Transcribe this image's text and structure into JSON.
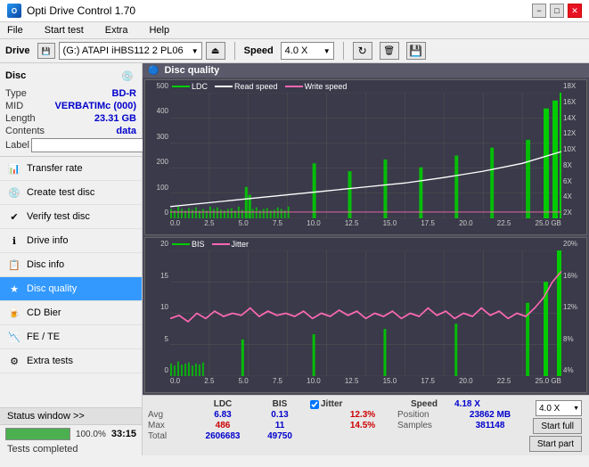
{
  "titlebar": {
    "title": "Opti Drive Control 1.70",
    "icon": "O",
    "minimize": "−",
    "maximize": "□",
    "close": "✕"
  },
  "menubar": {
    "items": [
      "File",
      "Start test",
      "Extra",
      "Help"
    ]
  },
  "toolbar": {
    "drive_label": "Drive",
    "drive_value": "(G:) ATAPI iHBS112  2 PL06",
    "speed_label": "Speed",
    "speed_value": "4.0 X"
  },
  "disc": {
    "title": "Disc",
    "type_label": "Type",
    "type_value": "BD-R",
    "mid_label": "MID",
    "mid_value": "VERBATIMc (000)",
    "length_label": "Length",
    "length_value": "23.31 GB",
    "contents_label": "Contents",
    "contents_value": "data",
    "label_label": "Label",
    "label_placeholder": ""
  },
  "sidebar": {
    "items": [
      {
        "id": "transfer-rate",
        "label": "Transfer rate",
        "icon": "📊"
      },
      {
        "id": "create-test-disc",
        "label": "Create test disc",
        "icon": "💿"
      },
      {
        "id": "verify-test-disc",
        "label": "Verify test disc",
        "icon": "✔"
      },
      {
        "id": "drive-info",
        "label": "Drive info",
        "icon": "ℹ"
      },
      {
        "id": "disc-info",
        "label": "Disc info",
        "icon": "📋"
      },
      {
        "id": "disc-quality",
        "label": "Disc quality",
        "icon": "★",
        "active": true
      },
      {
        "id": "cd-bier",
        "label": "CD Bier",
        "icon": "🍺"
      },
      {
        "id": "fe-te",
        "label": "FE / TE",
        "icon": "📉"
      },
      {
        "id": "extra-tests",
        "label": "Extra tests",
        "icon": "⚙"
      }
    ]
  },
  "status": {
    "window_btn": "Status window >>",
    "message": "Tests completed",
    "progress": 100,
    "progress_text": "100.0%",
    "time": "33:15"
  },
  "disc_quality": {
    "title": "Disc quality"
  },
  "chart_top": {
    "legend": [
      {
        "label": "LDC",
        "color": "#00ff00"
      },
      {
        "label": "Read speed",
        "color": "#ffffff"
      },
      {
        "label": "Write speed",
        "color": "#ff69b4"
      }
    ],
    "y_left": [
      "500",
      "400",
      "300",
      "200",
      "100",
      "0"
    ],
    "y_right": [
      "18X",
      "16X",
      "14X",
      "12X",
      "10X",
      "8X",
      "6X",
      "4X",
      "2X"
    ],
    "x_labels": [
      "0.0",
      "2.5",
      "5.0",
      "7.5",
      "10.0",
      "12.5",
      "15.0",
      "17.5",
      "20.0",
      "22.5",
      "25.0 GB"
    ]
  },
  "chart_bottom": {
    "legend": [
      {
        "label": "BIS",
        "color": "#00ff00"
      },
      {
        "label": "Jitter",
        "color": "#ff69b4"
      }
    ],
    "y_left": [
      "20",
      "15",
      "10",
      "5",
      "0"
    ],
    "y_right": [
      "20%",
      "16%",
      "12%",
      "8%",
      "4%"
    ],
    "x_labels": [
      "0.0",
      "2.5",
      "5.0",
      "7.5",
      "10.0",
      "12.5",
      "15.0",
      "17.5",
      "20.0",
      "22.5",
      "25.0 GB"
    ]
  },
  "stats": {
    "col_ldc": "LDC",
    "col_bis": "BIS",
    "col_jitter": "Jitter",
    "col_speed": "Speed",
    "avg_label": "Avg",
    "avg_ldc": "6.83",
    "avg_bis": "0.13",
    "avg_jitter": "12.3%",
    "avg_speed": "4.18 X",
    "max_label": "Max",
    "max_ldc": "486",
    "max_bis": "11",
    "max_jitter": "14.5%",
    "max_position": "23862 MB",
    "total_label": "Total",
    "total_ldc": "2606683",
    "total_bis": "49750",
    "total_samples": "381148",
    "position_label": "Position",
    "samples_label": "Samples",
    "speed_label": "Speed",
    "speed_dropdown": "4.0 X",
    "btn_full": "Start full",
    "btn_part": "Start part",
    "jitter_checked": true
  }
}
